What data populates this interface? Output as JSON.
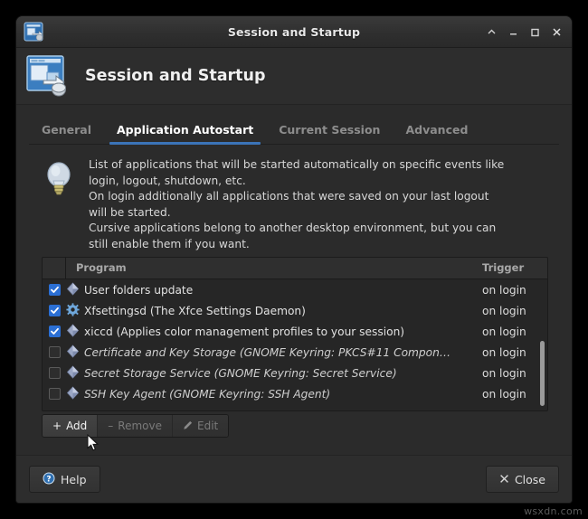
{
  "window": {
    "title": "Session and Startup",
    "icon": "session-startup-icon",
    "titlebar_buttons": [
      {
        "name": "shade-button",
        "glyph": "^"
      },
      {
        "name": "minimize-button",
        "glyph": "_"
      },
      {
        "name": "maximize-button",
        "glyph": "□"
      },
      {
        "name": "close-button",
        "glyph": "×"
      }
    ]
  },
  "header": {
    "title": "Session and Startup",
    "icon": "session-startup-large-icon"
  },
  "tabs": [
    {
      "label": "General",
      "active": false
    },
    {
      "label": "Application Autostart",
      "active": true
    },
    {
      "label": "Current Session",
      "active": false
    },
    {
      "label": "Advanced",
      "active": false
    }
  ],
  "info": {
    "icon": "lightbulb-icon",
    "lines": [
      "List of applications that will be started automatically on specific events like",
      "login, logout, shutdown, etc.",
      "On login additionally all applications that were saved on your last logout",
      "will be started.",
      "Cursive applications belong to another desktop environment, but you can",
      "still enable them if you want."
    ]
  },
  "list": {
    "columns": {
      "program": "Program",
      "trigger": "Trigger"
    },
    "rows": [
      {
        "checked": true,
        "icon": "diamond-icon",
        "name": "User folders update",
        "trigger": "on login",
        "cursive": false
      },
      {
        "checked": true,
        "icon": "gear-icon",
        "name": "Xfsettingsd (The Xfce Settings Daemon)",
        "trigger": "on login",
        "cursive": false
      },
      {
        "checked": true,
        "icon": "diamond-icon",
        "name": "xiccd (Applies color management profiles to your session)",
        "trigger": "on login",
        "cursive": false
      },
      {
        "checked": false,
        "icon": "diamond-icon",
        "name": "Certificate and Key Storage (GNOME Keyring: PKCS#11 Compon…",
        "trigger": "on login",
        "cursive": true
      },
      {
        "checked": false,
        "icon": "diamond-icon",
        "name": "Secret Storage Service (GNOME Keyring: Secret Service)",
        "trigger": "on login",
        "cursive": true
      },
      {
        "checked": false,
        "icon": "diamond-icon",
        "name": "SSH Key Agent (GNOME Keyring: SSH Agent)",
        "trigger": "on login",
        "cursive": true
      }
    ]
  },
  "actions": [
    {
      "label": "Add",
      "glyph": "+",
      "state": "hover"
    },
    {
      "label": "Remove",
      "glyph": "–",
      "state": "disabled"
    },
    {
      "label": "Edit",
      "glyph": "pencil-icon",
      "state": "disabled"
    }
  ],
  "footer": {
    "help_label": "Help",
    "close_label": "Close"
  },
  "watermark": "wsxdn.com",
  "colors": {
    "accent": "#3b74b8",
    "checkbox_checked": "#2b6fd4",
    "window_bg": "#2b2b2b",
    "list_bg": "#262626",
    "text": "#e2e2e2"
  }
}
